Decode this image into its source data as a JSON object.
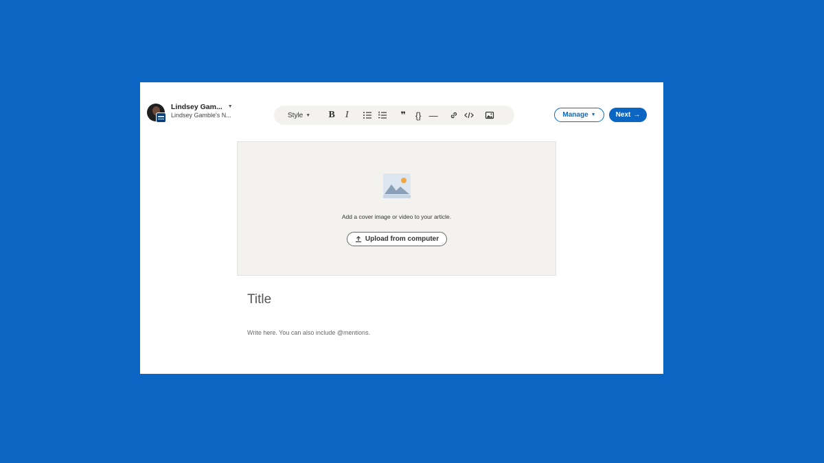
{
  "author": {
    "name": "Lindsey Gam...",
    "newsletter": "Lindsey Gamble's N..."
  },
  "toolbar": {
    "style_label": "Style",
    "bold_label": "B",
    "italic_label": "I",
    "quote_label": "❞",
    "code_label": "{}",
    "divider_label": "—"
  },
  "actions": {
    "manage_label": "Manage",
    "next_label": "Next"
  },
  "cover": {
    "prompt": "Add a cover image or video to your article.",
    "upload_label": "Upload from computer"
  },
  "editor": {
    "title_placeholder": "Title",
    "body_placeholder": "Write here. You can also include @mentions."
  },
  "colors": {
    "background": "#0a66c2",
    "accent": "#0a66c2",
    "cover_bg": "#f3f2ef"
  }
}
